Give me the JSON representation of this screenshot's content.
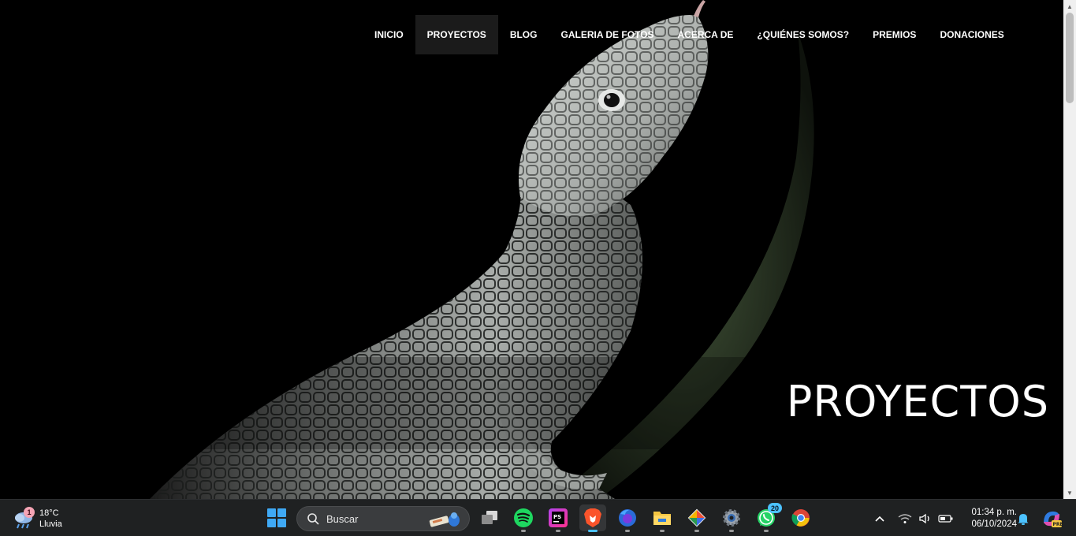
{
  "nav": {
    "items": [
      {
        "label": "INICIO",
        "active": false
      },
      {
        "label": "PROYECTOS",
        "active": true
      },
      {
        "label": "BLOG",
        "active": false
      },
      {
        "label": "GALERIA DE FOTOS",
        "active": false
      },
      {
        "label": "ACERCA DE",
        "active": false
      },
      {
        "label": "¿QUIÉNES SOMOS?",
        "active": false
      },
      {
        "label": "PREMIOS",
        "active": false
      },
      {
        "label": "DONACIONES",
        "active": false
      }
    ]
  },
  "hero": {
    "title": "PROYECTOS",
    "image_icon": "lizard-photo"
  },
  "taskbar": {
    "weather": {
      "temperature": "18°C",
      "condition": "Lluvia",
      "badge": "1",
      "icon": "rain-cloud-icon"
    },
    "search": {
      "placeholder": "Buscar"
    },
    "apps": [
      {
        "name": "task-view",
        "icon": "task-view-icon",
        "badge": ""
      },
      {
        "name": "spotify",
        "icon": "spotify-icon",
        "badge": ""
      },
      {
        "name": "phpstorm",
        "icon": "phpstorm-icon",
        "badge": ""
      },
      {
        "name": "brave",
        "icon": "brave-icon",
        "badge": ""
      },
      {
        "name": "firefox",
        "icon": "firefox-icon",
        "badge": ""
      },
      {
        "name": "file-explorer",
        "icon": "folder-icon",
        "badge": ""
      },
      {
        "name": "git-client",
        "icon": "git-icon",
        "badge": ""
      },
      {
        "name": "settings",
        "icon": "gear-icon",
        "badge": ""
      },
      {
        "name": "whatsapp",
        "icon": "whatsapp-icon",
        "badge": "20"
      },
      {
        "name": "chrome",
        "icon": "chrome-icon",
        "badge": ""
      }
    ],
    "clock": {
      "time": "01:34 p. m.",
      "date": "06/10/2024"
    }
  },
  "colors": {
    "accent": "#4cc2ff",
    "nav_active_bg": "#1b1b1b",
    "taskbar_bg": "#1f2122"
  }
}
